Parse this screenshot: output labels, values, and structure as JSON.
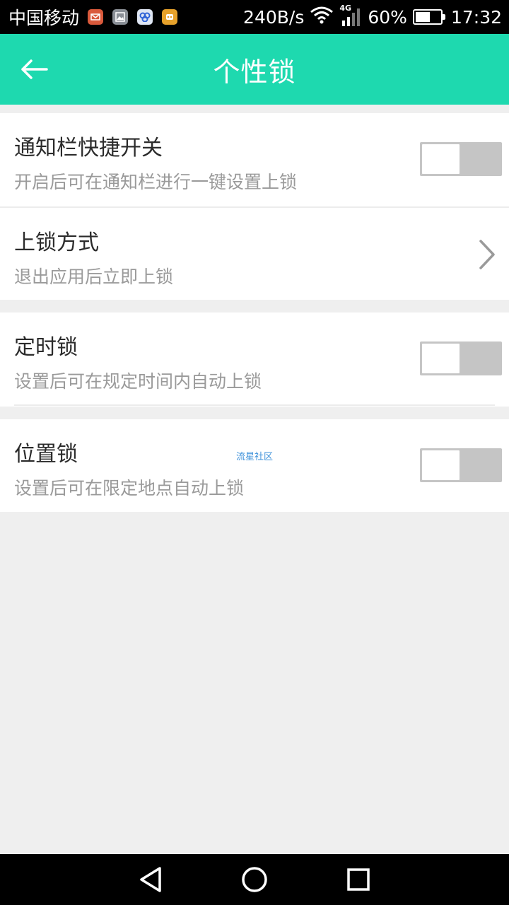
{
  "status_bar": {
    "carrier": "中国移动",
    "net_speed": "240B/s",
    "network_type": "4G",
    "battery": "60%",
    "battery_level": 0.6,
    "time": "17:32",
    "notification_icons": [
      "mail-app-icon",
      "gallery-app-icon",
      "baidu-app-icon",
      "game-app-icon"
    ]
  },
  "app_bar": {
    "title": "个性锁",
    "back_icon": "arrow-left-icon",
    "color": "#1ed9af"
  },
  "settings": {
    "group1": [
      {
        "title": "通知栏快捷开关",
        "subtitle": "开启后可在通知栏进行一键设置上锁",
        "control": "toggle",
        "enabled": false
      },
      {
        "title": "上锁方式",
        "subtitle": "退出应用后立即上锁",
        "control": "chevron"
      }
    ],
    "group2": [
      {
        "title": "定时锁",
        "subtitle": "设置后可在规定时间内自动上锁",
        "control": "toggle",
        "enabled": false
      }
    ],
    "group3": [
      {
        "title": "位置锁",
        "subtitle": "设置后可在限定地点自动上锁",
        "control": "toggle",
        "enabled": false
      }
    ]
  },
  "watermark": "流星社区",
  "nav_bar": {
    "icons": [
      "back-triangle-icon",
      "home-circle-icon",
      "recents-square-icon"
    ]
  }
}
